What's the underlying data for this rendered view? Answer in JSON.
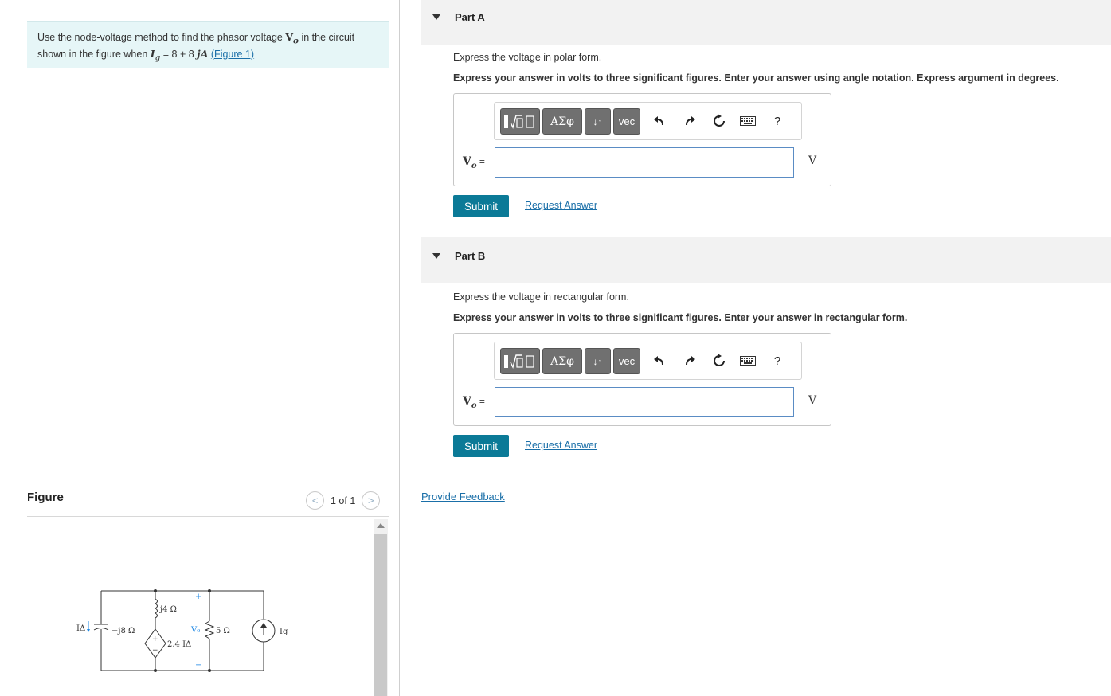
{
  "problem": {
    "text_before": "Use the node-voltage method to find the phasor voltage ",
    "voltage_symbol": "V",
    "voltage_sub": "o",
    "text_middle": " in the circuit shown in the figure when ",
    "current_symbol": "I",
    "current_sub": "g",
    "current_value_start": " = 8 + 8 ",
    "current_value_j": "jA",
    "figure_link": "(Figure 1)"
  },
  "figure": {
    "label": "Figure",
    "pager_text": "1 of 1",
    "prev_glyph": "<",
    "next_glyph": ">",
    "circuit": {
      "ia_label": "IΔ",
      "cap_label": "−j8 Ω",
      "ind_label": "j4 Ω",
      "source_label": "2.4 IΔ",
      "vo_label": "V₀",
      "plus": "+",
      "minus": "−",
      "res_label": "5 Ω",
      "ig_label": "Ig"
    }
  },
  "partA": {
    "title": "Part A",
    "instruction": "Express the voltage in polar form.",
    "instruction_bold": "Express your answer in volts to three significant figures. Enter your answer using angle notation. Express argument in degrees.",
    "var_symbol": "V",
    "var_sub": "o",
    "var_eq": " =",
    "input_value": "",
    "unit": "V",
    "submit_label": "Submit",
    "request_label": "Request Answer"
  },
  "partB": {
    "title": "Part B",
    "instruction": "Express the voltage in rectangular form.",
    "instruction_bold": "Express your answer in volts to three significant figures. Enter your answer in rectangular form.",
    "var_symbol": "V",
    "var_sub": "o",
    "var_eq": " =",
    "input_value": "",
    "unit": "V",
    "submit_label": "Submit",
    "request_label": "Request Answer"
  },
  "toolbar": {
    "greek_label": "ΑΣφ",
    "arrows_label": "↓↑",
    "vec_label": "vec",
    "help_label": "?"
  },
  "feedback_label": "Provide Feedback",
  "colors": {
    "accent": "#0b7a97",
    "link": "#1a6fa8",
    "problem_bg": "#e6f6f7",
    "header_bg": "#f2f2f2"
  }
}
